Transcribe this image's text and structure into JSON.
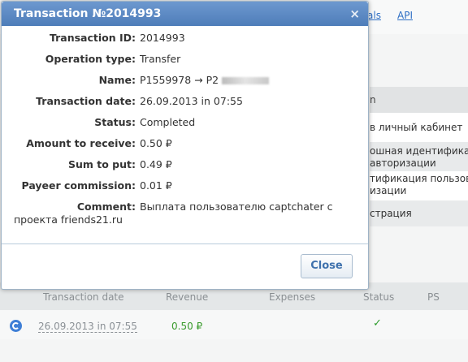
{
  "background": {
    "nav": [
      "als",
      "API"
    ],
    "panel_title": "n",
    "panel_items": [
      "в личный кабинет",
      "ошная идентифика",
      "авторизации",
      "тификация пользова",
      "изации",
      "страция"
    ],
    "table_headers": [
      "Transaction date",
      "Revenue",
      "Expenses",
      "Status",
      "PS"
    ],
    "row": {
      "date": "26.09.2013 in 07:55",
      "revenue": "0.50 ₽"
    },
    "colors": {
      "link": "#2d6ec4",
      "revenue": "#3a9b2c",
      "status_ok": "#2e9c2e"
    },
    "icons": {
      "row_icon": "sync-icon",
      "status_icon": "checkmark-icon"
    }
  },
  "modal": {
    "title": "Transaction №2014993",
    "close_glyph": "×",
    "fields": [
      {
        "label": "Transaction ID:",
        "value": "2014993"
      },
      {
        "label": "Operation type:",
        "value": "Transfer"
      },
      {
        "label": "Name:",
        "value": "P1559978 → P2"
      },
      {
        "label": "Transaction date:",
        "value": "26.09.2013 in 07:55"
      },
      {
        "label": "Status:",
        "value": "Completed"
      },
      {
        "label": "Amount to receive:",
        "value": "0.50 ₽"
      },
      {
        "label": "Sum to put:",
        "value": "0.49 ₽"
      },
      {
        "label": "Payeer commission:",
        "value": "0.01 ₽"
      }
    ],
    "comment_label": "Comment:",
    "comment_line1": "Выплата пользователю captchater с",
    "comment_line2": "проекта friends21.ru",
    "close_button": "Close"
  }
}
